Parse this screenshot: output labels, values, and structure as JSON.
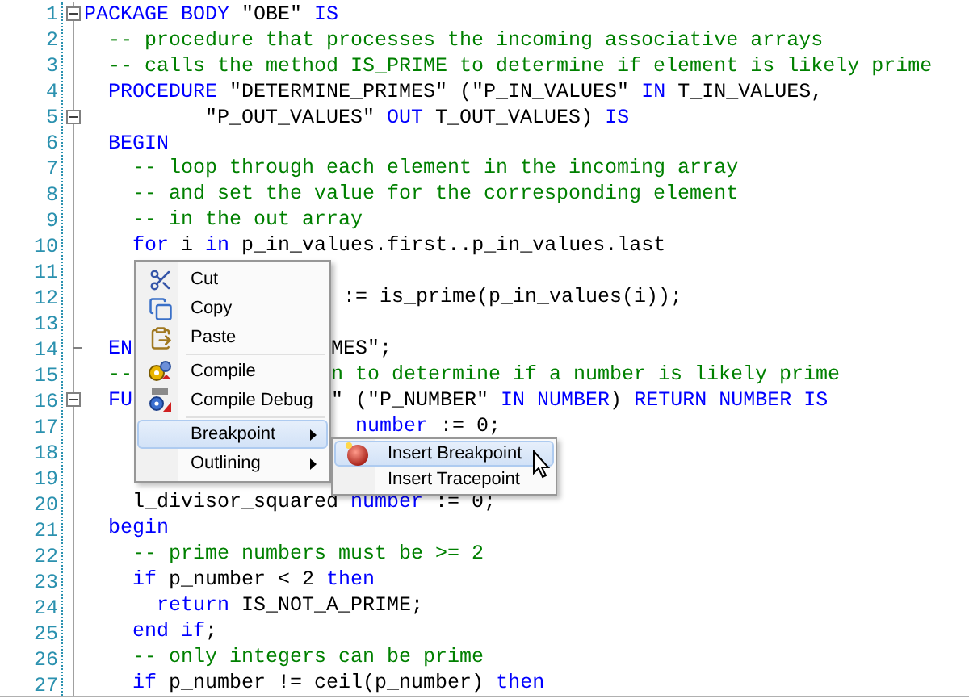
{
  "editor": {
    "lines": [
      {
        "number": "1",
        "kind": "collapsible",
        "tokens": [
          {
            "kind": "keyword",
            "text": "PACKAGE BODY"
          },
          {
            "kind": "plain",
            "text": " \"OBE\" "
          },
          {
            "kind": "keyword",
            "text": "IS"
          }
        ]
      },
      {
        "number": "2",
        "tokens": [
          {
            "kind": "comment",
            "text": "  -- procedure that processes the incoming associative arrays"
          }
        ]
      },
      {
        "number": "3",
        "tokens": [
          {
            "kind": "comment",
            "text": "  -- calls the method IS_PRIME to determine if element is likely prime"
          }
        ]
      },
      {
        "number": "4",
        "tokens": [
          {
            "kind": "keyword",
            "text": "  PROCEDURE"
          },
          {
            "kind": "plain",
            "text": " \"DETERMINE_PRIMES\" (\"P_IN_VALUES\" "
          },
          {
            "kind": "keyword",
            "text": "IN"
          },
          {
            "kind": "plain",
            "text": " T_IN_VALUES,"
          }
        ]
      },
      {
        "number": "5",
        "kind": "collapsible",
        "tokens": [
          {
            "kind": "plain",
            "text": "          \"P_OUT_VALUES\" "
          },
          {
            "kind": "keyword",
            "text": "OUT"
          },
          {
            "kind": "plain",
            "text": " T_OUT_VALUES) "
          },
          {
            "kind": "keyword",
            "text": "IS"
          }
        ]
      },
      {
        "number": "6",
        "tokens": [
          {
            "kind": "keyword",
            "text": "  BEGIN"
          }
        ]
      },
      {
        "number": "7",
        "tokens": [
          {
            "kind": "comment",
            "text": "    -- loop through each element in the incoming array"
          }
        ]
      },
      {
        "number": "8",
        "tokens": [
          {
            "kind": "comment",
            "text": "    -- and set the value for the corresponding element"
          }
        ]
      },
      {
        "number": "9",
        "tokens": [
          {
            "kind": "comment",
            "text": "    -- in the out array"
          }
        ]
      },
      {
        "number": "10",
        "tokens": [
          {
            "kind": "keyword",
            "text": "    for"
          },
          {
            "kind": "plain",
            "text": " i "
          },
          {
            "kind": "keyword",
            "text": "in"
          },
          {
            "kind": "plain",
            "text": " p_in_values.first..p_in_values.last"
          }
        ]
      },
      {
        "number": "11"
      },
      {
        "number": "12",
        "right": [
          {
            "kind": "plain",
            "text": " := is_prime(p_in_values(i));"
          }
        ]
      },
      {
        "number": "13"
      },
      {
        "number": "14",
        "kind": "blockend",
        "left": [
          {
            "kind": "keyword",
            "text": "  EN"
          }
        ],
        "right": [
          {
            "kind": "plain",
            "text": "MES\";"
          }
        ]
      },
      {
        "number": "15",
        "left": [
          {
            "kind": "comment",
            "text": "  --"
          }
        ],
        "right": [
          {
            "kind": "comment",
            "text": "n to determine if a number is likely prime"
          }
        ]
      },
      {
        "number": "16",
        "kind": "collapsible",
        "left": [
          {
            "kind": "keyword",
            "text": "  FU"
          }
        ],
        "right": [
          {
            "kind": "plain",
            "text": "\" (\"P_NUMBER\" "
          },
          {
            "kind": "keyword",
            "text": "IN NUMBER"
          },
          {
            "kind": "plain",
            "text": ") "
          },
          {
            "kind": "keyword",
            "text": "RETURN NUMBER IS"
          }
        ]
      },
      {
        "number": "17",
        "right": [
          {
            "kind": "keyword",
            "text": "  number"
          },
          {
            "kind": "plain",
            "text": " := 0;"
          }
        ]
      },
      {
        "number": "18"
      },
      {
        "number": "19"
      },
      {
        "number": "20",
        "tokens": [
          {
            "kind": "plain",
            "text": "    l_divisor_squared "
          },
          {
            "kind": "keyword",
            "text": "number"
          },
          {
            "kind": "plain",
            "text": " := 0;"
          }
        ]
      },
      {
        "number": "21",
        "tokens": [
          {
            "kind": "keyword",
            "text": "  begin"
          }
        ]
      },
      {
        "number": "22",
        "tokens": [
          {
            "kind": "comment",
            "text": "    -- prime numbers must be >= 2"
          }
        ]
      },
      {
        "number": "23",
        "tokens": [
          {
            "kind": "keyword",
            "text": "    if"
          },
          {
            "kind": "plain",
            "text": " p_number < 2 "
          },
          {
            "kind": "keyword",
            "text": "then"
          }
        ]
      },
      {
        "number": "24",
        "tokens": [
          {
            "kind": "keyword",
            "text": "      return"
          },
          {
            "kind": "plain",
            "text": " IS_NOT_A_PRIME;"
          }
        ]
      },
      {
        "number": "25",
        "tokens": [
          {
            "kind": "keyword",
            "text": "    end if"
          },
          {
            "kind": "plain",
            "text": ";"
          }
        ]
      },
      {
        "number": "26",
        "tokens": [
          {
            "kind": "comment",
            "text": "    -- only integers can be prime"
          }
        ]
      },
      {
        "number": "27",
        "tokens": [
          {
            "kind": "keyword",
            "text": "    if"
          },
          {
            "kind": "plain",
            "text": " p_number != ceil(p_number) "
          },
          {
            "kind": "keyword",
            "text": "then"
          }
        ]
      }
    ]
  },
  "context_menu": {
    "items": [
      {
        "kind": "item",
        "label": "Cut",
        "selected": false,
        "has_submenu": false
      },
      {
        "kind": "item",
        "label": "Copy",
        "selected": false,
        "has_submenu": false
      },
      {
        "kind": "item",
        "label": "Paste",
        "selected": false,
        "has_submenu": false
      },
      {
        "kind": "separator"
      },
      {
        "kind": "item",
        "label": "Compile",
        "selected": false,
        "has_submenu": false
      },
      {
        "kind": "item",
        "label": "Compile Debug",
        "selected": false,
        "has_submenu": false
      },
      {
        "kind": "separator"
      },
      {
        "kind": "item",
        "label": "Breakpoint",
        "selected": true,
        "has_submenu": true
      },
      {
        "kind": "item",
        "label": "Outlining",
        "selected": false,
        "has_submenu": true
      }
    ]
  },
  "submenu": {
    "items": [
      {
        "label": "Insert Breakpoint",
        "selected": true
      },
      {
        "label": "Insert Tracepoint",
        "selected": false
      }
    ]
  }
}
